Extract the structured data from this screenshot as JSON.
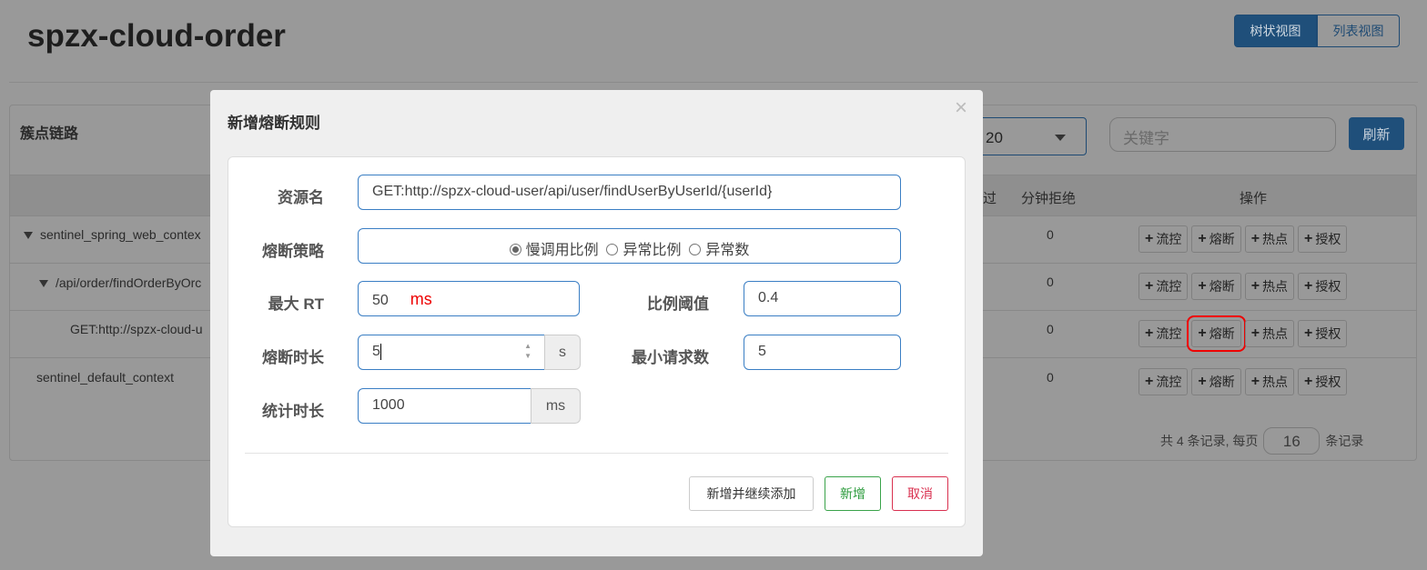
{
  "page": {
    "title": "spzx-cloud-order",
    "view_tree": "树状视图",
    "view_list": "列表视图"
  },
  "panel": {
    "title": "簇点链路",
    "page_size_select": "20",
    "keyword_placeholder": "关键字",
    "refresh": "刷新",
    "headers": {
      "passed_partial": "过",
      "rejected": "分钟拒绝",
      "actions": "操作"
    },
    "rows": [
      {
        "name": "sentinel_spring_web_contex",
        "rejected": "0",
        "expanded": true
      },
      {
        "name": "/api/order/findOrderByOrc",
        "rejected": "0",
        "expanded": true
      },
      {
        "name": "GET:http://spzx-cloud-u",
        "rejected": "0"
      },
      {
        "name": "sentinel_default_context",
        "rejected": "0"
      }
    ],
    "op_labels": {
      "flow": "流控",
      "degrade": "熔断",
      "hotspot": "热点",
      "auth": "授权"
    },
    "pagination": {
      "prefix": "共 4 条记录, 每页",
      "page_size": "16",
      "suffix": "条记录"
    }
  },
  "modal": {
    "title": "新增熔断规则",
    "close": "×",
    "resource_label": "资源名",
    "resource_value": "GET:http://spzx-cloud-user/api/user/findUserByUserId/{userId}",
    "strategy_label": "熔断策略",
    "strategy_options": [
      "慢调用比例",
      "异常比例",
      "异常数"
    ],
    "strategy_selected": "慢调用比例",
    "max_rt_label": "最大 RT",
    "max_rt_value": "50",
    "max_rt_annotation": "ms",
    "ratio_label": "比例阈值",
    "ratio_value": "0.4",
    "duration_label": "熔断时长",
    "duration_value": "5",
    "duration_unit": "s",
    "min_req_label": "最小请求数",
    "min_req_value": "5",
    "stat_label": "统计时长",
    "stat_value": "1000",
    "stat_unit": "ms",
    "btn_add_continue": "新增并继续添加",
    "btn_add": "新增",
    "btn_cancel": "取消"
  }
}
